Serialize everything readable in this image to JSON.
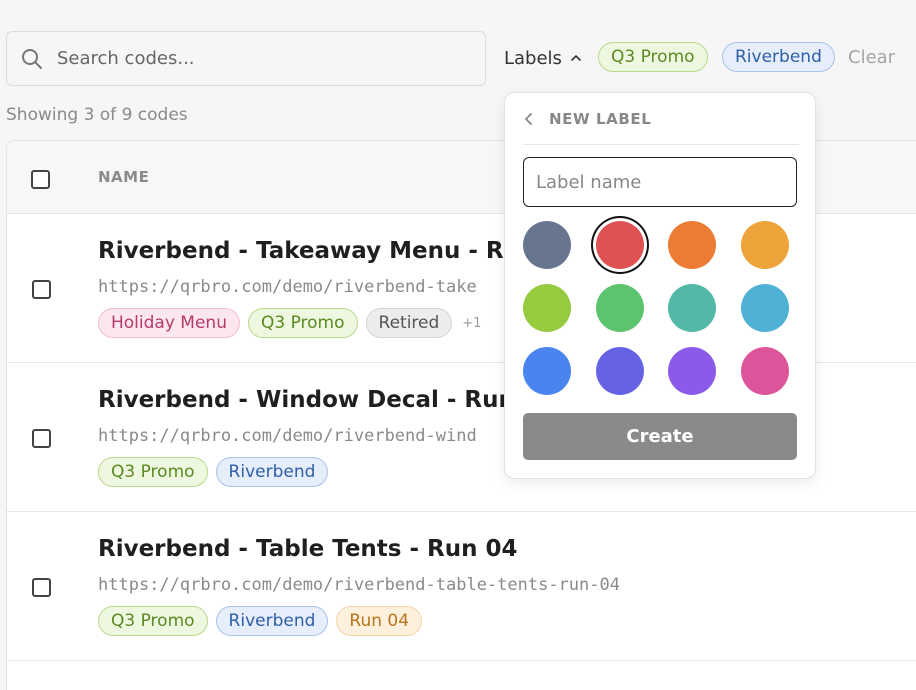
{
  "search": {
    "placeholder": "Search codes..."
  },
  "filters": {
    "labels_toggle": "Labels",
    "active": [
      "Q3 Promo",
      "Riverbend"
    ],
    "clear": "Clear"
  },
  "summary": "Showing 3 of 9 codes",
  "table": {
    "columns": [
      "NAME"
    ],
    "rows": [
      {
        "title": "Riverbend - Takeaway Menu - Run 0",
        "url": "https://qrbro.com/demo/riverbend-take",
        "tags": [
          "Holiday Menu",
          "Q3 Promo",
          "Retired"
        ],
        "more": "+1"
      },
      {
        "title": "Riverbend - Window Decal - Run 02",
        "url": "https://qrbro.com/demo/riverbend-wind",
        "tags": [
          "Q3 Promo",
          "Riverbend"
        ]
      },
      {
        "title": "Riverbend - Table Tents - Run 04",
        "url": "https://qrbro.com/demo/riverbend-table-tents-run-04",
        "tags": [
          "Q3 Promo",
          "Riverbend",
          "Run 04"
        ]
      }
    ]
  },
  "popover": {
    "title": "NEW LABEL",
    "input_placeholder": "Label name",
    "create_label": "Create",
    "selected_color": "#e05252",
    "colors": [
      "#68758f",
      "#e05252",
      "#ec7b33",
      "#eba33a",
      "#97cb3f",
      "#5cc46c",
      "#54b8a9",
      "#4fb1d4",
      "#4a84ee",
      "#6563e4",
      "#8b5ae8",
      "#dc549a"
    ]
  }
}
